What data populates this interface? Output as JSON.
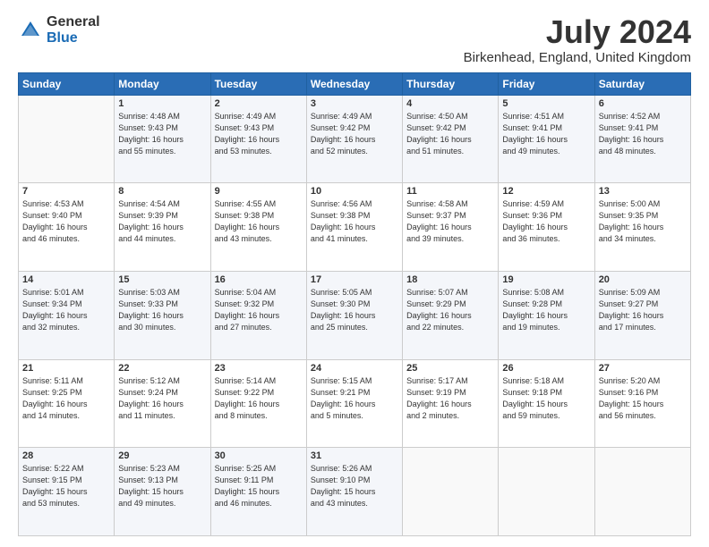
{
  "logo": {
    "general": "General",
    "blue": "Blue"
  },
  "title": "July 2024",
  "location": "Birkenhead, England, United Kingdom",
  "weekdays": [
    "Sunday",
    "Monday",
    "Tuesday",
    "Wednesday",
    "Thursday",
    "Friday",
    "Saturday"
  ],
  "weeks": [
    [
      {
        "day": "",
        "info": ""
      },
      {
        "day": "1",
        "info": "Sunrise: 4:48 AM\nSunset: 9:43 PM\nDaylight: 16 hours\nand 55 minutes."
      },
      {
        "day": "2",
        "info": "Sunrise: 4:49 AM\nSunset: 9:43 PM\nDaylight: 16 hours\nand 53 minutes."
      },
      {
        "day": "3",
        "info": "Sunrise: 4:49 AM\nSunset: 9:42 PM\nDaylight: 16 hours\nand 52 minutes."
      },
      {
        "day": "4",
        "info": "Sunrise: 4:50 AM\nSunset: 9:42 PM\nDaylight: 16 hours\nand 51 minutes."
      },
      {
        "day": "5",
        "info": "Sunrise: 4:51 AM\nSunset: 9:41 PM\nDaylight: 16 hours\nand 49 minutes."
      },
      {
        "day": "6",
        "info": "Sunrise: 4:52 AM\nSunset: 9:41 PM\nDaylight: 16 hours\nand 48 minutes."
      }
    ],
    [
      {
        "day": "7",
        "info": "Sunrise: 4:53 AM\nSunset: 9:40 PM\nDaylight: 16 hours\nand 46 minutes."
      },
      {
        "day": "8",
        "info": "Sunrise: 4:54 AM\nSunset: 9:39 PM\nDaylight: 16 hours\nand 44 minutes."
      },
      {
        "day": "9",
        "info": "Sunrise: 4:55 AM\nSunset: 9:38 PM\nDaylight: 16 hours\nand 43 minutes."
      },
      {
        "day": "10",
        "info": "Sunrise: 4:56 AM\nSunset: 9:38 PM\nDaylight: 16 hours\nand 41 minutes."
      },
      {
        "day": "11",
        "info": "Sunrise: 4:58 AM\nSunset: 9:37 PM\nDaylight: 16 hours\nand 39 minutes."
      },
      {
        "day": "12",
        "info": "Sunrise: 4:59 AM\nSunset: 9:36 PM\nDaylight: 16 hours\nand 36 minutes."
      },
      {
        "day": "13",
        "info": "Sunrise: 5:00 AM\nSunset: 9:35 PM\nDaylight: 16 hours\nand 34 minutes."
      }
    ],
    [
      {
        "day": "14",
        "info": "Sunrise: 5:01 AM\nSunset: 9:34 PM\nDaylight: 16 hours\nand 32 minutes."
      },
      {
        "day": "15",
        "info": "Sunrise: 5:03 AM\nSunset: 9:33 PM\nDaylight: 16 hours\nand 30 minutes."
      },
      {
        "day": "16",
        "info": "Sunrise: 5:04 AM\nSunset: 9:32 PM\nDaylight: 16 hours\nand 27 minutes."
      },
      {
        "day": "17",
        "info": "Sunrise: 5:05 AM\nSunset: 9:30 PM\nDaylight: 16 hours\nand 25 minutes."
      },
      {
        "day": "18",
        "info": "Sunrise: 5:07 AM\nSunset: 9:29 PM\nDaylight: 16 hours\nand 22 minutes."
      },
      {
        "day": "19",
        "info": "Sunrise: 5:08 AM\nSunset: 9:28 PM\nDaylight: 16 hours\nand 19 minutes."
      },
      {
        "day": "20",
        "info": "Sunrise: 5:09 AM\nSunset: 9:27 PM\nDaylight: 16 hours\nand 17 minutes."
      }
    ],
    [
      {
        "day": "21",
        "info": "Sunrise: 5:11 AM\nSunset: 9:25 PM\nDaylight: 16 hours\nand 14 minutes."
      },
      {
        "day": "22",
        "info": "Sunrise: 5:12 AM\nSunset: 9:24 PM\nDaylight: 16 hours\nand 11 minutes."
      },
      {
        "day": "23",
        "info": "Sunrise: 5:14 AM\nSunset: 9:22 PM\nDaylight: 16 hours\nand 8 minutes."
      },
      {
        "day": "24",
        "info": "Sunrise: 5:15 AM\nSunset: 9:21 PM\nDaylight: 16 hours\nand 5 minutes."
      },
      {
        "day": "25",
        "info": "Sunrise: 5:17 AM\nSunset: 9:19 PM\nDaylight: 16 hours\nand 2 minutes."
      },
      {
        "day": "26",
        "info": "Sunrise: 5:18 AM\nSunset: 9:18 PM\nDaylight: 15 hours\nand 59 minutes."
      },
      {
        "day": "27",
        "info": "Sunrise: 5:20 AM\nSunset: 9:16 PM\nDaylight: 15 hours\nand 56 minutes."
      }
    ],
    [
      {
        "day": "28",
        "info": "Sunrise: 5:22 AM\nSunset: 9:15 PM\nDaylight: 15 hours\nand 53 minutes."
      },
      {
        "day": "29",
        "info": "Sunrise: 5:23 AM\nSunset: 9:13 PM\nDaylight: 15 hours\nand 49 minutes."
      },
      {
        "day": "30",
        "info": "Sunrise: 5:25 AM\nSunset: 9:11 PM\nDaylight: 15 hours\nand 46 minutes."
      },
      {
        "day": "31",
        "info": "Sunrise: 5:26 AM\nSunset: 9:10 PM\nDaylight: 15 hours\nand 43 minutes."
      },
      {
        "day": "",
        "info": ""
      },
      {
        "day": "",
        "info": ""
      },
      {
        "day": "",
        "info": ""
      }
    ]
  ]
}
